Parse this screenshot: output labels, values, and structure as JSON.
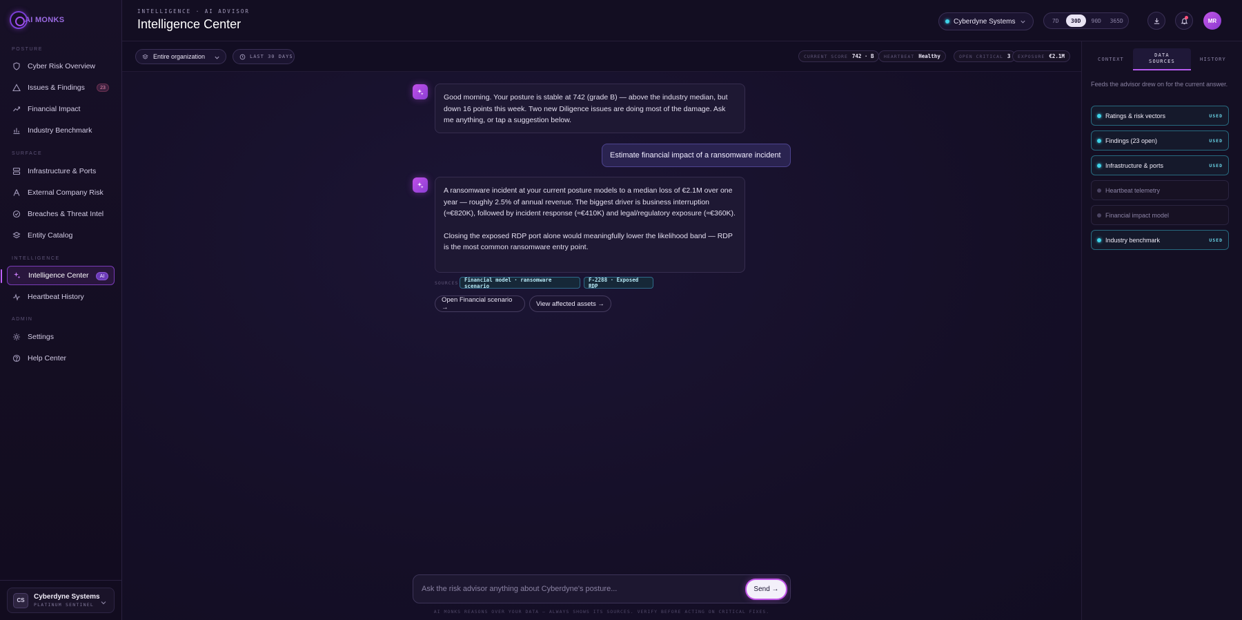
{
  "brand": {
    "logo_text": "AI MONKS"
  },
  "sidebar": {
    "sections": [
      {
        "label": "POSTURE"
      },
      {
        "label": "SURFACE"
      },
      {
        "label": "INTELLIGENCE"
      },
      {
        "label": "ADMIN"
      }
    ],
    "items": [
      {
        "label": "Cyber Risk Overview",
        "icon": "shield-icon"
      },
      {
        "label": "Issues & Findings",
        "icon": "warning-icon",
        "badge": "23"
      },
      {
        "label": "Financial Impact",
        "icon": "financial-icon"
      },
      {
        "label": "Industry Benchmark",
        "icon": "bar-chart-icon"
      },
      {
        "label": "Infrastructure & Ports",
        "icon": "server-icon"
      },
      {
        "label": "External Company Risk",
        "icon": "branch-icon"
      },
      {
        "label": "Breaches & Threat Intel",
        "icon": "target-icon"
      },
      {
        "label": "Entity Catalog",
        "icon": "layers-icon"
      },
      {
        "label": "Intelligence Center",
        "icon": "sparkle-icon",
        "badge": "AI",
        "active": true
      },
      {
        "label": "Heartbeat History",
        "icon": "pulse-icon"
      },
      {
        "label": "Settings",
        "icon": "gear-icon"
      },
      {
        "label": "Help Center",
        "icon": "help-icon"
      }
    ],
    "org": {
      "initials": "CS",
      "name": "Cyberdyne Systems",
      "tier": "PLATINUM SENTINEL"
    }
  },
  "header": {
    "eyebrow": "INTELLIGENCE · AI ADVISOR",
    "title": "Intelligence Center",
    "org_select": "Cyberdyne Systems",
    "ranges": [
      "7D",
      "30D",
      "90D",
      "365D"
    ],
    "selected_range": "30D",
    "user_initials": "MR"
  },
  "toolbar": {
    "scope": "Entire organization",
    "period": "LAST 30 DAYS",
    "stats": [
      {
        "key": "CURRENT SCORE",
        "value": "742 · B"
      },
      {
        "key": "HEARTBEAT",
        "value": "Healthy"
      },
      {
        "key": "OPEN CRITICAL",
        "value": "3"
      },
      {
        "key": "EXPOSURE",
        "value": "€2.1M"
      }
    ]
  },
  "chat": {
    "messages": [
      {
        "role": "assistant",
        "text": "Good morning. Your posture is stable at 742 (grade B) — above the industry median, but down 16 points this week. Two new Diligence issues are doing most of the damage. Ask me anything, or tap a suggestion below."
      },
      {
        "role": "user",
        "text": "Estimate financial impact of a ransomware incident"
      },
      {
        "role": "assistant",
        "text_p1": "A ransomware incident at your current posture models to a median loss of €2.1M over one year — roughly 2.5% of annual revenue. The biggest driver is business interruption (≈€820K), followed by incident response (≈€410K) and legal/regulatory exposure (≈€360K).",
        "text_p2": "Closing the exposed RDP port alone would meaningfully lower the likelihood band — RDP is the most common ransomware entry point."
      }
    ],
    "sources_label": "SOURCES",
    "sources": [
      "Financial model · ransomware scenario",
      "F-2288 · Exposed RDP"
    ],
    "actions": [
      "Open Financial scenario →",
      "View affected assets →"
    ],
    "composer_placeholder": "Ask the risk advisor anything about Cyberdyne's posture...",
    "send_label": "Send →",
    "disclaimer": "AI MONKS REASONS OVER YOUR DATA — ALWAYS SHOWS ITS SOURCES. VERIFY BEFORE ACTING ON CRITICAL FIXES."
  },
  "right_panel": {
    "tabs": [
      "CONTEXT",
      "DATA SOURCES",
      "HISTORY"
    ],
    "active_tab": "DATA SOURCES",
    "description": "Feeds the advisor drew on for the current answer.",
    "used_label": "USED",
    "sources": [
      {
        "label": "Ratings & risk vectors",
        "used": true
      },
      {
        "label": "Findings (23 open)",
        "used": true
      },
      {
        "label": "Infrastructure & ports",
        "used": true
      },
      {
        "label": "Heartbeat telemetry",
        "used": false
      },
      {
        "label": "Financial impact model",
        "used": false
      },
      {
        "label": "Industry benchmark",
        "used": true
      }
    ]
  },
  "colors": {
    "accent": "#b65bf0",
    "cyan": "#3fd2e8",
    "background": "#120d22"
  }
}
